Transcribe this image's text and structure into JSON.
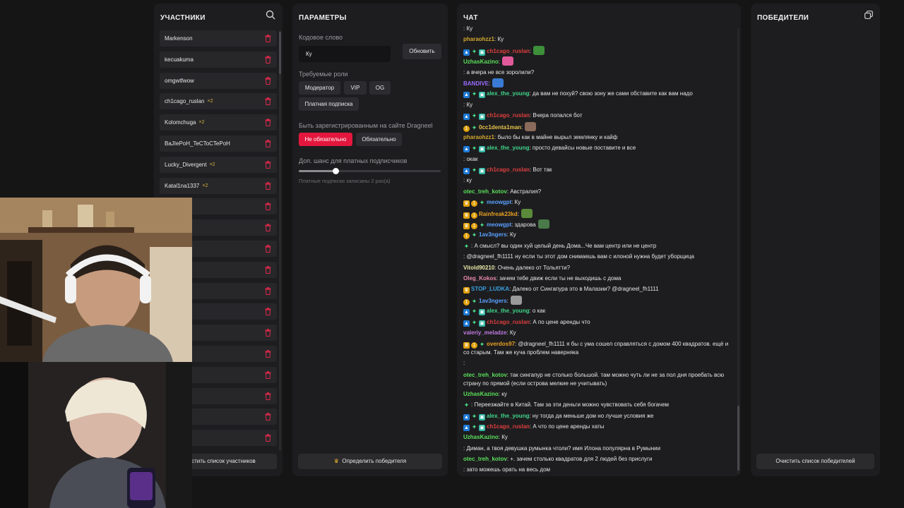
{
  "participants": {
    "title": "УЧАСТНИКИ",
    "items": [
      {
        "name": "Markenson",
        "mult": ""
      },
      {
        "name": "kecuakuma",
        "mult": ""
      },
      {
        "name": "omgwtfwow",
        "mult": ""
      },
      {
        "name": "ch1cago_ruslan",
        "mult": "×2"
      },
      {
        "name": "Kolomchuga",
        "mult": "×2"
      },
      {
        "name": "BaJIePoH_TeCToCTePoH",
        "mult": ""
      },
      {
        "name": "Lucky_Divergent",
        "mult": "×2"
      },
      {
        "name": "Katal1na1337",
        "mult": "×2"
      },
      {
        "name": "",
        "mult": ""
      },
      {
        "name": "",
        "mult": ""
      },
      {
        "name": "",
        "mult": ""
      },
      {
        "name": "",
        "mult": ""
      },
      {
        "name": "",
        "mult": ""
      },
      {
        "name": "",
        "mult": ""
      },
      {
        "name": "",
        "mult": ""
      },
      {
        "name": "",
        "mult": ""
      },
      {
        "name": "",
        "mult": ""
      },
      {
        "name": "",
        "mult": ""
      },
      {
        "name": "",
        "mult": ""
      },
      {
        "name": "",
        "mult": ""
      }
    ],
    "clear_label": "Очистить список участников"
  },
  "params": {
    "title": "ПАРАМЕТРЫ",
    "codeword_label": "Кодовое слово",
    "codeword_value": "Ку",
    "update_label": "Обновить",
    "roles_label": "Требуемые роли",
    "role_mod": "Модератор",
    "role_vip": "VIP",
    "role_og": "OG",
    "role_paid": "Платная подписка",
    "registered_label": "Быть зарегистрированным на сайте Dragneel",
    "opt_not_required": "Не обязательно",
    "opt_required": "Обязательно",
    "chance_label": "Доп. шанс для платных подписчиков",
    "chance_value": 0.26,
    "chance_note": "Платные подписки записаны 2 раз(а)",
    "winner_btn": "Определить победителя"
  },
  "chat": {
    "title": "ЧАТ",
    "messages": [
      {
        "user": "",
        "color": "#e6e6e6",
        "badges": [],
        "text": ": Ку",
        "emote": ""
      },
      {
        "user": "pharaohzz1",
        "color": "#d4a72c",
        "badges": [],
        "text": ": Ку",
        "emote": ""
      },
      {
        "user": "ch1cago_ruslan",
        "color": "#e03e3e",
        "badges": [
          "prime",
          "star",
          "gift"
        ],
        "text": ":",
        "emote": "#3d8f3a"
      },
      {
        "user": "UzhasKazino",
        "color": "#5ae05a",
        "badges": [],
        "text": ":",
        "emote": "#e05a9a"
      },
      {
        "user": "",
        "color": "#e03e3e",
        "badges": [],
        "text": ": а вчера не все зоролили?",
        "emote": ""
      },
      {
        "user": "BANDIVE",
        "color": "#9b6bff",
        "badges": [],
        "text": ":",
        "emote": "#3a7bd5"
      },
      {
        "user": "alex_the_young",
        "color": "#3fd68a",
        "badges": [
          "prime",
          "star",
          "gift"
        ],
        "text": ": да вам не похуй? свою зону же сами обставите как вам надо",
        "emote": ""
      },
      {
        "user": "",
        "color": "#e03e3e",
        "badges": [],
        "text": ": Ку",
        "emote": ""
      },
      {
        "user": "ch1cago_ruslan",
        "color": "#e03e3e",
        "badges": [
          "prime",
          "star",
          "gift"
        ],
        "text": ": Вчера попался бот",
        "emote": ""
      },
      {
        "user": "0cc1denta1man",
        "color": "#e8c24a",
        "badges": [
          "one",
          "star"
        ],
        "text": ":",
        "emote": "#8a6a5a"
      },
      {
        "user": "pharaohzz1",
        "color": "#d4a72c",
        "badges": [],
        "text": ": было бы как в майне вырыл землянку и кайф",
        "emote": ""
      },
      {
        "user": "alex_the_young",
        "color": "#3fd68a",
        "badges": [
          "prime",
          "star",
          "gift"
        ],
        "text": ": просто девайсы новые поставите и все",
        "emote": ""
      },
      {
        "user": "",
        "color": "#b040d0",
        "badges": [],
        "text": ": окак",
        "emote": ""
      },
      {
        "user": "ch1cago_ruslan",
        "color": "#e03e3e",
        "badges": [
          "prime",
          "star",
          "gift"
        ],
        "text": ": Вот так",
        "emote": ""
      },
      {
        "user": "",
        "color": "#e03e3e",
        "badges": [],
        "text": ": ку",
        "emote": ""
      },
      {
        "user": "otec_treh_kotov",
        "color": "#5ae05a",
        "badges": [],
        "text": ": Австралия?",
        "emote": ""
      },
      {
        "user": "meowgpt",
        "color": "#5aa0ff",
        "badges": [
          "crown",
          "one",
          "star"
        ],
        "text": ": Ку",
        "emote": ""
      },
      {
        "user": "Rainfreak23kd",
        "color": "#e8a020",
        "badges": [
          "crown",
          "one"
        ],
        "text": ":",
        "emote": "#5a8a3a"
      },
      {
        "user": "meowgpt",
        "color": "#5aa0ff",
        "badges": [
          "crown",
          "one",
          "star"
        ],
        "text": ": здарова",
        "emote": "#4a7a4a"
      },
      {
        "user": "1av3ngers",
        "color": "#5aa0ff",
        "badges": [
          "one",
          "star"
        ],
        "text": ": Ку",
        "emote": ""
      },
      {
        "user": "",
        "color": "#e03e3e",
        "badges": [
          "star"
        ],
        "text": ": А смысл? вы один хуй целый день Дома...Че вам центр или не центр",
        "emote": ""
      },
      {
        "user": "",
        "color": "#e03e3e",
        "badges": [],
        "text": ": @dragneel_fh1111 ну если ты этот дом снимаешь вам с илоной нужна будет уборщица",
        "emote": ""
      },
      {
        "user": "Vitold90210",
        "color": "#e8e8a8",
        "badges": [],
        "text": ": Очень далеко от Тольятти?",
        "emote": ""
      },
      {
        "user": "Oleg_Kokos",
        "color": "#e88aa8",
        "badges": [],
        "text": ": зачем тебе движ если ты не выходишь с дома",
        "emote": ""
      },
      {
        "user": "STOP_LUDKA",
        "color": "#3aa0e0",
        "badges": [
          "crown"
        ],
        "text": ": Далеко от Сингапура это в Малазии? @dragneel_fh1111",
        "emote": ""
      },
      {
        "user": "1av3ngers",
        "color": "#5aa0ff",
        "badges": [
          "one",
          "star"
        ],
        "text": ":",
        "emote": "#9a9a9a"
      },
      {
        "user": "alex_the_young",
        "color": "#3fd68a",
        "badges": [
          "prime",
          "star",
          "gift"
        ],
        "text": ": о как",
        "emote": ""
      },
      {
        "user": "ch1cago_ruslan",
        "color": "#e03e3e",
        "badges": [
          "prime",
          "star",
          "gift"
        ],
        "text": ": А по цене аренды что",
        "emote": ""
      },
      {
        "user": "valeriy_meladze",
        "color": "#c07ae0",
        "badges": [],
        "text": ": Ку",
        "emote": ""
      },
      {
        "user": "overdos97",
        "color": "#e8a020",
        "badges": [
          "crown",
          "one",
          "star"
        ],
        "text": ": @dragneel_fh1111 я бы с ума сошел справляться с домом 400 квадратов. ещё и со старым. Там же куча проблем наверняка",
        "emote": "",
        "wrap": true
      },
      {
        "user": "",
        "color": "#e03e3e",
        "badges": [],
        "text": ":",
        "emote": ""
      },
      {
        "user": "otec_treh_kotov",
        "color": "#5ae05a",
        "badges": [],
        "text": ": так сингапур не столько большой. там можно чуть ли не за пол дня проебать всю страну по прямой (если острова мелкие не учитывать)",
        "emote": "",
        "wrap": true
      },
      {
        "user": "UzhasKazino",
        "color": "#5ae05a",
        "badges": [],
        "text": ": ку",
        "emote": ""
      },
      {
        "user": "",
        "color": "#e03e3e",
        "badges": [
          "star"
        ],
        "text": ": Переезжайте в Китай. Там за эти деньги можно чувствовать себя богачем",
        "emote": ""
      },
      {
        "user": "alex_the_young",
        "color": "#3fd68a",
        "badges": [
          "prime",
          "star",
          "gift"
        ],
        "text": ": ну тогда да меньше дом но лучше условия же",
        "emote": ""
      },
      {
        "user": "ch1cago_ruslan",
        "color": "#e03e3e",
        "badges": [
          "prime",
          "star",
          "gift"
        ],
        "text": ": А что по цене аренды хаты",
        "emote": ""
      },
      {
        "user": "UzhasKazino",
        "color": "#5ae05a",
        "badges": [],
        "text": ": Ку",
        "emote": ""
      },
      {
        "user": "",
        "color": "#e03e3e",
        "badges": [],
        "text": ": Диман, а твоя девушка румынка чтоли? имя Илона популярна в Румынии",
        "emote": ""
      },
      {
        "user": "otec_treh_kotov",
        "color": "#5ae05a",
        "badges": [],
        "text": ": +. зачем столько квадратов для 2 людей без прислуги",
        "emote": ""
      },
      {
        "user": "",
        "color": "#e03e3e",
        "badges": [],
        "text": ": зато можешь орать на весь дом",
        "emote": ""
      }
    ]
  },
  "winners": {
    "title": "ПОБЕДИТЕЛИ",
    "clear_label": "Очистить список победителей"
  },
  "colors": {
    "accent": "#e3173d",
    "panel": "#1d1d1f",
    "background": "#151516"
  }
}
